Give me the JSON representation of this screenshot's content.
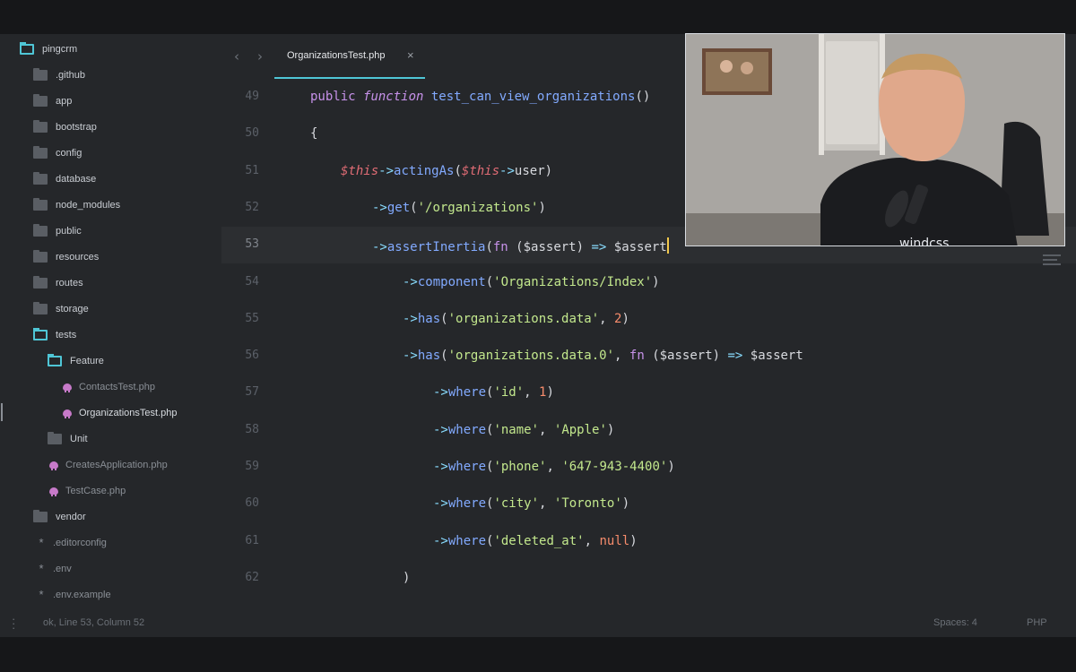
{
  "sidebar": {
    "root": "pingcrm",
    "items": [
      {
        "label": ".github",
        "kind": "folder"
      },
      {
        "label": "app",
        "kind": "folder"
      },
      {
        "label": "bootstrap",
        "kind": "folder"
      },
      {
        "label": "config",
        "kind": "folder"
      },
      {
        "label": "database",
        "kind": "folder"
      },
      {
        "label": "node_modules",
        "kind": "folder"
      },
      {
        "label": "public",
        "kind": "folder"
      },
      {
        "label": "resources",
        "kind": "folder"
      },
      {
        "label": "routes",
        "kind": "folder"
      },
      {
        "label": "storage",
        "kind": "folder"
      },
      {
        "label": "tests",
        "kind": "folder-open"
      },
      {
        "label": "Feature",
        "kind": "folder-open"
      },
      {
        "label": "ContactsTest.php",
        "kind": "php"
      },
      {
        "label": "OrganizationsTest.php",
        "kind": "php"
      },
      {
        "label": "Unit",
        "kind": "folder"
      },
      {
        "label": "CreatesApplication.php",
        "kind": "php"
      },
      {
        "label": "TestCase.php",
        "kind": "php"
      },
      {
        "label": "vendor",
        "kind": "folder"
      },
      {
        "label": ".editorconfig",
        "kind": "file"
      },
      {
        "label": ".env",
        "kind": "file"
      },
      {
        "label": ".env.example",
        "kind": "file"
      }
    ]
  },
  "tabs": {
    "back_glyph": "‹",
    "forward_glyph": "›",
    "active_label": "OrganizationsTest.php",
    "close_glyph": "×"
  },
  "editor": {
    "lines": [
      {
        "n": "49",
        "tokens": [
          [
            "kw",
            "public "
          ],
          [
            "kw-i",
            "function "
          ],
          [
            "fn",
            "test_can_view_organizations"
          ],
          [
            "pl",
            "()"
          ]
        ]
      },
      {
        "n": "50",
        "tokens": [
          [
            "pl",
            "{"
          ]
        ]
      },
      {
        "n": "51",
        "tokens": [
          [
            "var",
            "$this"
          ],
          [
            "arrow",
            "->"
          ],
          [
            "fn",
            "actingAs"
          ],
          [
            "pl",
            "("
          ],
          [
            "var",
            "$this"
          ],
          [
            "arrow",
            "->"
          ],
          [
            "pl",
            "user)"
          ]
        ]
      },
      {
        "n": "52",
        "tokens": [
          [
            "arrow",
            "->"
          ],
          [
            "fn",
            "get"
          ],
          [
            "pl",
            "("
          ],
          [
            "str",
            "'/organizations'"
          ],
          [
            "pl",
            ")"
          ]
        ]
      },
      {
        "n": "53",
        "tokens": [
          [
            "arrow",
            "->"
          ],
          [
            "fn",
            "assertInertia"
          ],
          [
            "pl",
            "("
          ],
          [
            "kw",
            "fn "
          ],
          [
            "pl",
            "($assert) "
          ],
          [
            "arrow",
            "=> "
          ],
          [
            "pl",
            "$assert"
          ]
        ]
      },
      {
        "n": "54",
        "tokens": [
          [
            "arrow",
            "->"
          ],
          [
            "fn",
            "component"
          ],
          [
            "pl",
            "("
          ],
          [
            "str",
            "'Organizations/Index'"
          ],
          [
            "pl",
            ")"
          ]
        ]
      },
      {
        "n": "55",
        "tokens": [
          [
            "arrow",
            "->"
          ],
          [
            "fn",
            "has"
          ],
          [
            "pl",
            "("
          ],
          [
            "str",
            "'organizations.data'"
          ],
          [
            "pl",
            ", "
          ],
          [
            "num",
            "2"
          ],
          [
            "pl",
            ")"
          ]
        ]
      },
      {
        "n": "56",
        "tokens": [
          [
            "arrow",
            "->"
          ],
          [
            "fn",
            "has"
          ],
          [
            "pl",
            "("
          ],
          [
            "str",
            "'organizations.data.0'"
          ],
          [
            "pl",
            ", "
          ],
          [
            "kw",
            "fn "
          ],
          [
            "pl",
            "($assert) "
          ],
          [
            "arrow",
            "=> "
          ],
          [
            "pl",
            "$assert"
          ]
        ]
      },
      {
        "n": "57",
        "tokens": [
          [
            "arrow",
            "->"
          ],
          [
            "fn",
            "where"
          ],
          [
            "pl",
            "("
          ],
          [
            "str",
            "'id'"
          ],
          [
            "pl",
            ", "
          ],
          [
            "num",
            "1"
          ],
          [
            "pl",
            ")"
          ]
        ]
      },
      {
        "n": "58",
        "tokens": [
          [
            "arrow",
            "->"
          ],
          [
            "fn",
            "where"
          ],
          [
            "pl",
            "("
          ],
          [
            "str",
            "'name'"
          ],
          [
            "pl",
            ", "
          ],
          [
            "str",
            "'Apple'"
          ],
          [
            "pl",
            ")"
          ]
        ]
      },
      {
        "n": "59",
        "tokens": [
          [
            "arrow",
            "->"
          ],
          [
            "fn",
            "where"
          ],
          [
            "pl",
            "("
          ],
          [
            "str",
            "'phone'"
          ],
          [
            "pl",
            ", "
          ],
          [
            "str",
            "'647-943-4400'"
          ],
          [
            "pl",
            ")"
          ]
        ]
      },
      {
        "n": "60",
        "tokens": [
          [
            "arrow",
            "->"
          ],
          [
            "fn",
            "where"
          ],
          [
            "pl",
            "("
          ],
          [
            "str",
            "'city'"
          ],
          [
            "pl",
            ", "
          ],
          [
            "str",
            "'Toronto'"
          ],
          [
            "pl",
            ")"
          ]
        ]
      },
      {
        "n": "61",
        "tokens": [
          [
            "arrow",
            "->"
          ],
          [
            "fn",
            "where"
          ],
          [
            "pl",
            "("
          ],
          [
            "str",
            "'deleted_at'"
          ],
          [
            "pl",
            ", "
          ],
          [
            "num",
            "null"
          ],
          [
            "pl",
            ")"
          ]
        ]
      },
      {
        "n": "62",
        "tokens": [
          [
            "pl",
            ")"
          ]
        ]
      }
    ]
  },
  "status": {
    "left": "ok, Line 53, Column 52",
    "spaces": "Spaces: 4",
    "language": "PHP"
  },
  "webcam": {
    "shirt_text": "windcss"
  },
  "colors": {
    "accent": "#4fc6d6",
    "cursor": "#f2c94c",
    "php_icon": "#c77ac9"
  }
}
